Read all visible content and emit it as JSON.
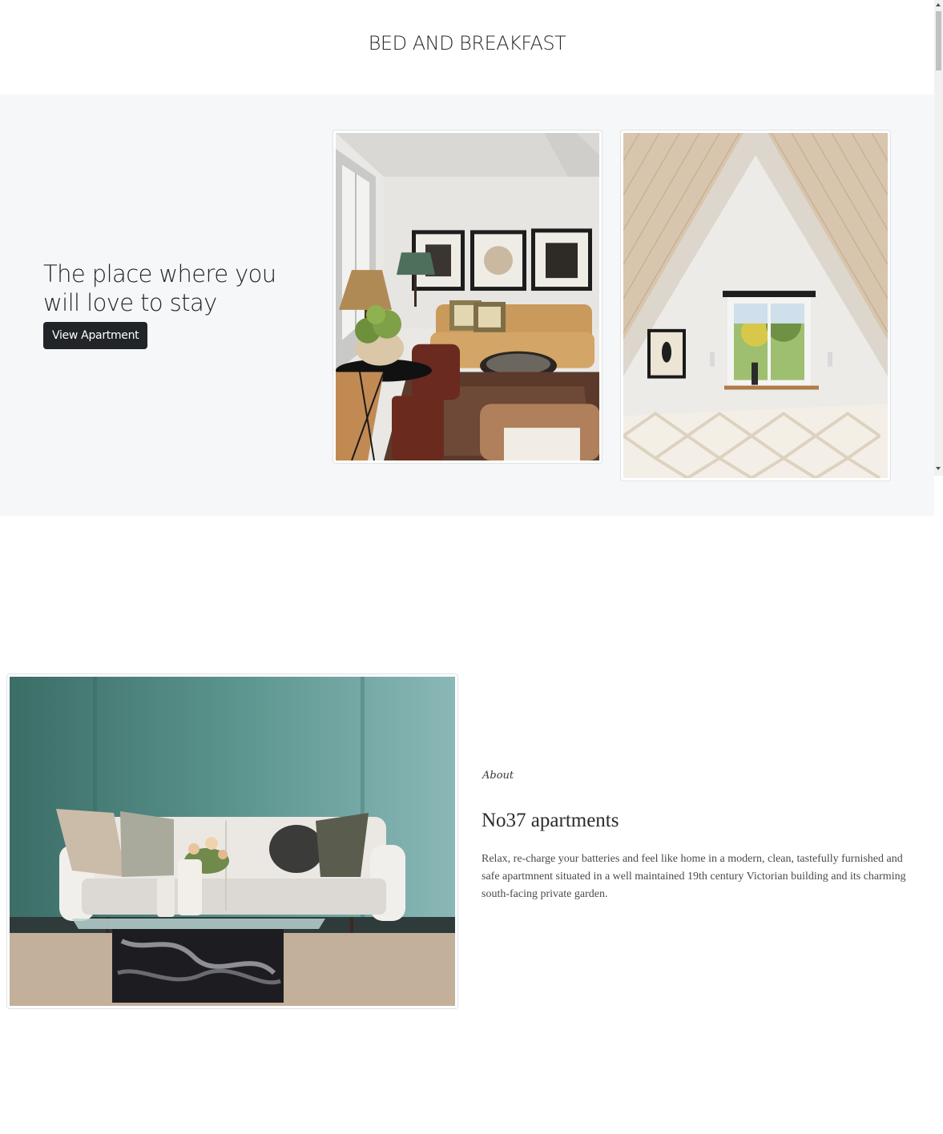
{
  "header": {
    "title": "BED AND BREAKFAST"
  },
  "hero": {
    "heading": "The place where you will love to stay",
    "button_label": "View Apartment",
    "images": [
      "living-room-photo",
      "attic-bedroom-photo"
    ]
  },
  "about": {
    "eyebrow": "About",
    "title": "No37 apartments",
    "text": "Relax, re-charge your batteries and feel like home in a modern, clean, tastefully furnished and safe apartmnent situated in a well maintained 19th century Victorian building and its charming south-facing private garden.",
    "image": "lounge-sofa-photo"
  },
  "colors": {
    "hero_bg": "#f6f7f9",
    "button_bg": "#212529",
    "button_text": "#ffffff"
  }
}
